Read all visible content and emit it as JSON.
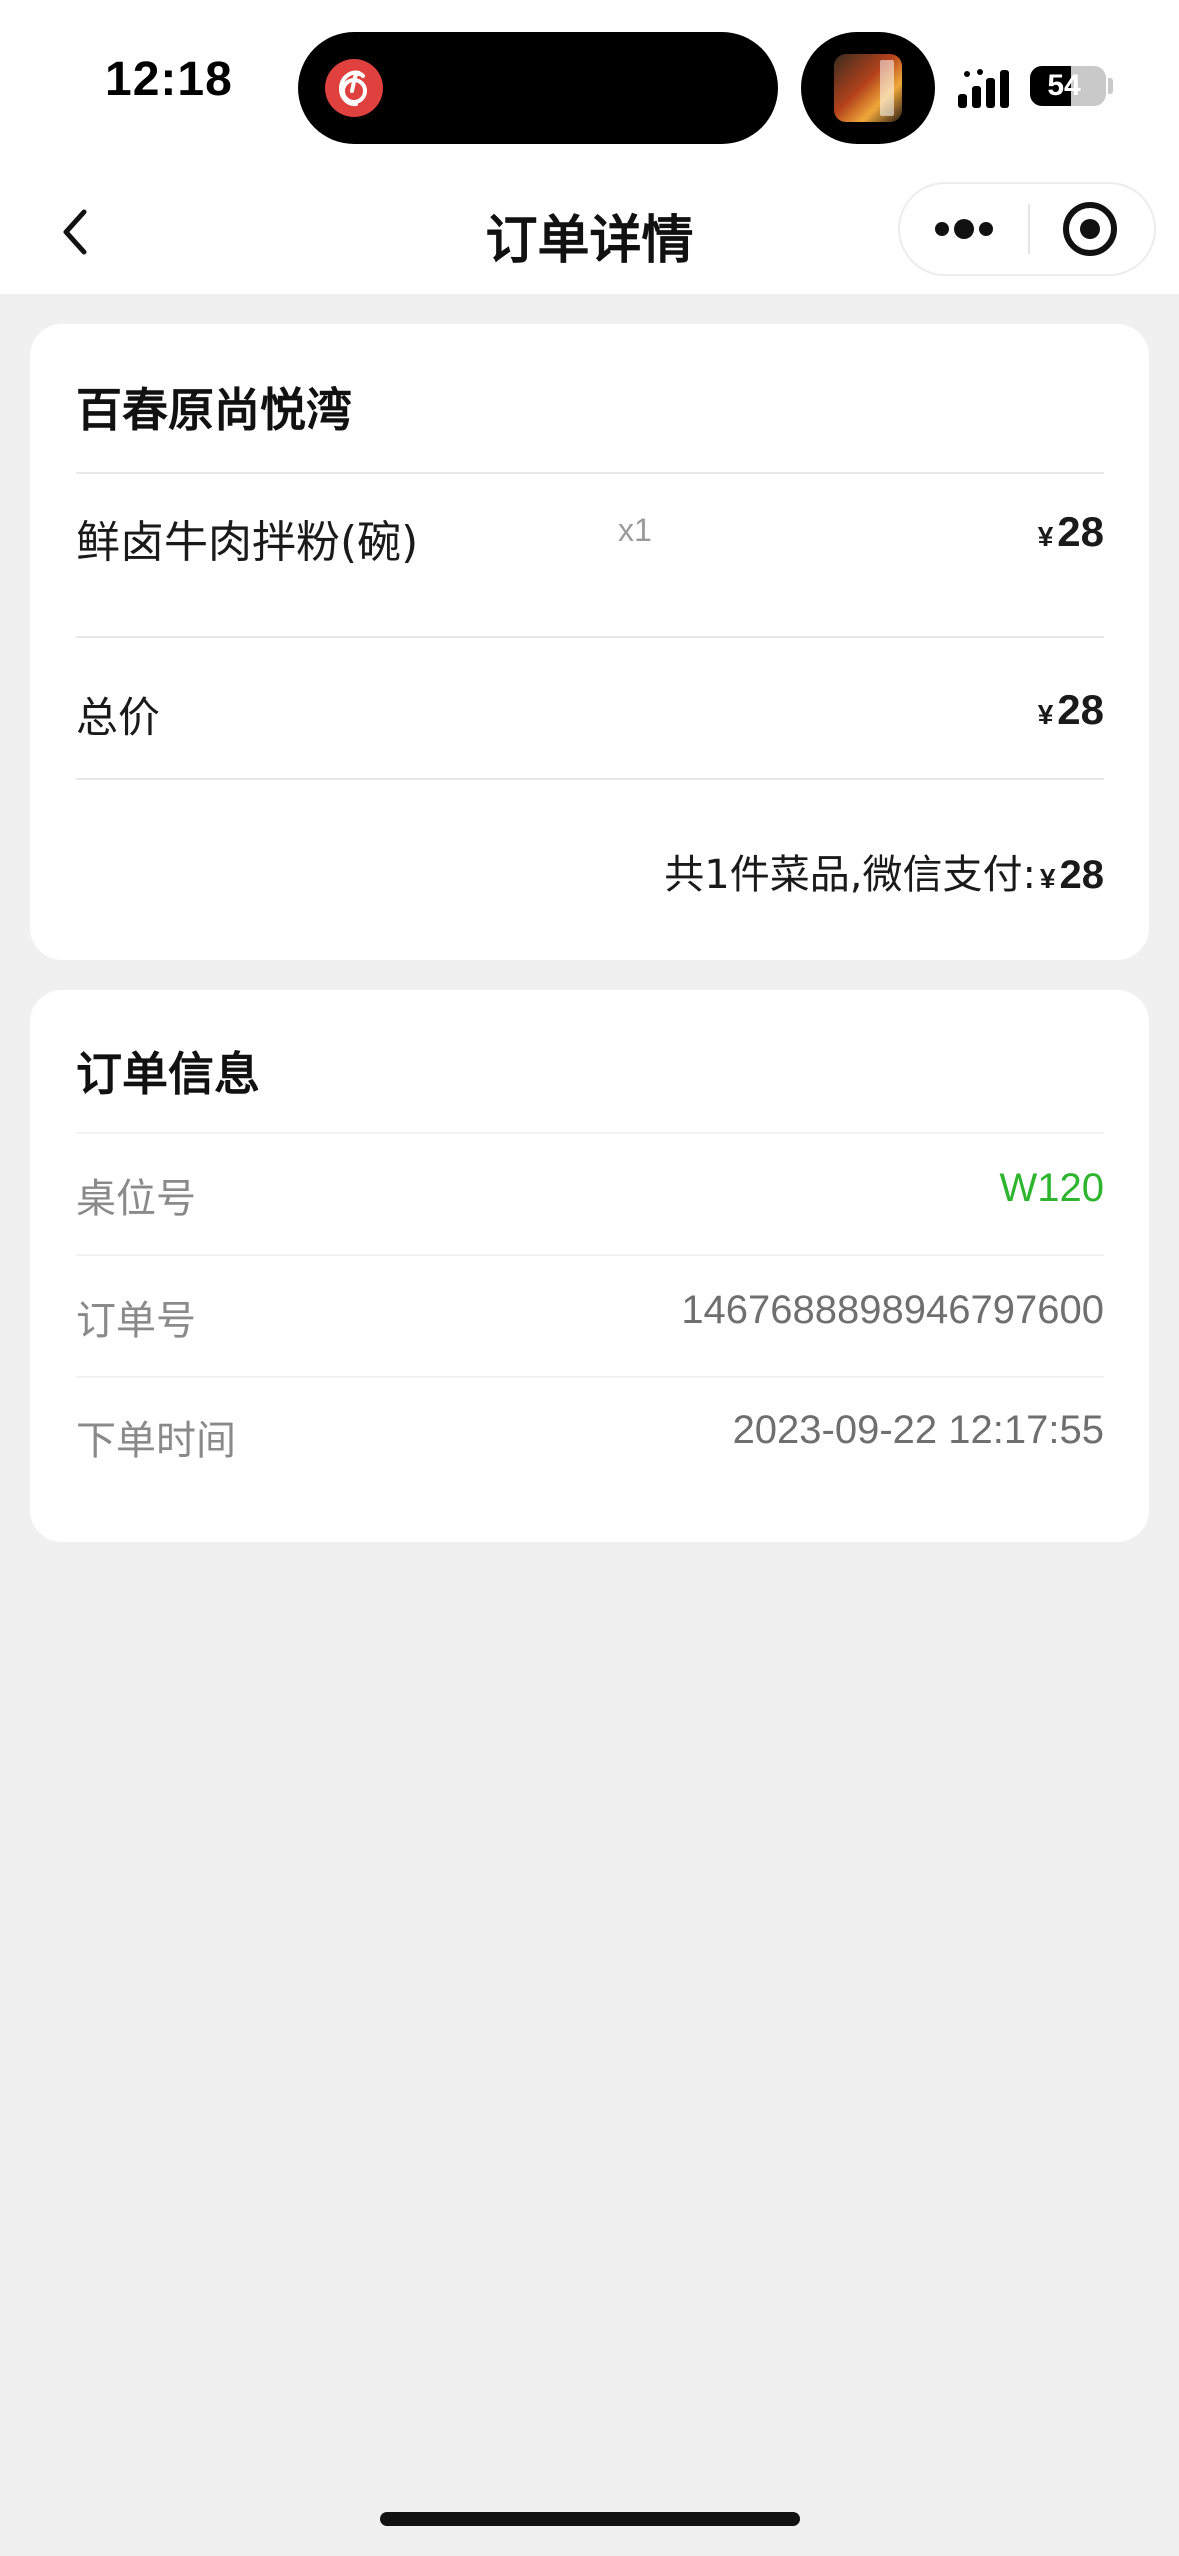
{
  "status_bar": {
    "time": "12:18",
    "battery": "54",
    "battery_level": 0.54
  },
  "nav": {
    "title": "订单详情"
  },
  "order_summary": {
    "shop_name": "百春原尚悦湾",
    "items": [
      {
        "name": "鲜卤牛肉拌粉(碗)",
        "qty": "x1",
        "currency": "¥",
        "price": "28"
      }
    ],
    "total_label": "总价",
    "total_currency": "¥",
    "total_price": "28",
    "payment_summary": "共1件菜品,微信支付:",
    "payment_currency": "¥",
    "payment_amount": "28"
  },
  "order_info": {
    "title": "订单信息",
    "rows": [
      {
        "label": "桌位号",
        "value": "W120"
      },
      {
        "label": "订单号",
        "value": "1467688898946797600"
      },
      {
        "label": "下单时间",
        "value": "2023-09-22 12:17:55"
      }
    ]
  },
  "colors": {
    "background": "#f0f0f0",
    "card": "#ffffff",
    "table_number": "#2db52d",
    "netease_red": "#e0403e"
  }
}
